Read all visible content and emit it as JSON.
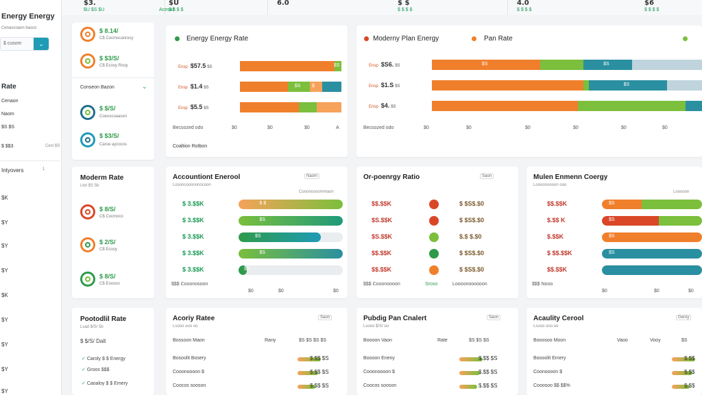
{
  "top": {
    "metrics": [
      {
        "value": "$3.",
        "sub": "$U $S $U"
      },
      {
        "value": "$U",
        "sub": "$ $ $ $"
      },
      {
        "value": "6.0",
        "sub": "Acesalt"
      },
      {
        "value": "$ $",
        "sub": "$ $ $ $"
      },
      {
        "value": "4.0",
        "sub": "$ $ $ $"
      },
      {
        "value": "$6",
        "sub": "$ $ $ $"
      }
    ]
  },
  "sidebar": {
    "title": "Energy Energy",
    "subtitle": "Cenascoaon basco",
    "select_value": "$ cusom",
    "heading": "Rate",
    "rows": [
      {
        "label": "Cenaon",
        "right": ""
      },
      {
        "label": "Naom",
        "right": ""
      },
      {
        "label": "$S $S",
        "right": ""
      },
      {
        "label": "$ $$3",
        "right": "Cest   $S"
      }
    ],
    "list_heading": "Intyovers",
    "list_right": "1",
    "list": [
      "$K",
      "$Y",
      "$Y",
      "$Y",
      "$Y",
      "$K",
      "$Y",
      "$Y",
      "$Y"
    ]
  },
  "icon_card_top": {
    "items": [
      {
        "value": "$ 8.14/",
        "sub": "C$ Cocmocanrocy"
      },
      {
        "value": "$ $3/S/",
        "sub": "C$ Ecooy Rooy"
      }
    ],
    "dropdown": "Conseon Bazon",
    "items2": [
      {
        "value": "$ $/S/",
        "sub": "Coeoscoaacen"
      },
      {
        "value": "$ $3/S/",
        "sub": "Caroe aycocos"
      }
    ]
  },
  "card_energy_rate": {
    "legend": "Energy Energy Rate",
    "rows": [
      {
        "small": "Ensp",
        "big": "$57.5",
        "unit": "$S",
        "segs": [
          {
            "p": 0.93,
            "label": ""
          },
          {
            "p": 0.07,
            "label": "$S"
          }
        ]
      },
      {
        "small": "Ensp",
        "big": "$1.4",
        "unit": "$S",
        "segs": [
          {
            "p": 0.47,
            "label": ""
          },
          {
            "p": 0.22,
            "label": "$S"
          },
          {
            "p": 0.12,
            "label": "$"
          },
          {
            "p": 0.19,
            "label": ""
          }
        ]
      },
      {
        "small": "Ensp",
        "big": "$5.5",
        "unit": "$S",
        "segs": [
          {
            "p": 0.58,
            "label": ""
          },
          {
            "p": 0.18,
            "label": ""
          },
          {
            "p": 0.24,
            "label": ""
          }
        ]
      }
    ],
    "axis": [
      "Becsozed odo",
      "$0",
      "$0",
      "$0",
      "A"
    ],
    "footer": "Coaltion Rotbon"
  },
  "card_plan": {
    "legend1": "Moderny Plan Energy",
    "legend2": "Pan Rate",
    "rows": [
      {
        "small": "Ensp",
        "big": "$S6.",
        "unit": "$S",
        "segs": [
          {
            "p": 0.4,
            "label": "$S"
          },
          {
            "p": 0.16,
            "label": ""
          },
          {
            "p": 0.18,
            "label": "$S"
          },
          {
            "p": 0.26,
            "label": ""
          }
        ]
      },
      {
        "small": "Ensp",
        "big": "$1.S",
        "unit": "$S",
        "segs": [
          {
            "p": 0.56,
            "label": ""
          },
          {
            "p": 0.02,
            "label": ""
          },
          {
            "p": 0.29,
            "label": "$S"
          },
          {
            "p": 0.13,
            "label": ""
          }
        ]
      },
      {
        "small": "Ensp",
        "big": "$4.",
        "unit": "$S",
        "segs": [
          {
            "p": 0.54,
            "label": ""
          },
          {
            "p": 0.4,
            "label": ""
          },
          {
            "p": 0.06,
            "label": ""
          }
        ]
      }
    ],
    "axis": [
      "Becsozed odo",
      "$0",
      "$0",
      "$0",
      "$0",
      "$0",
      "$0",
      "$0"
    ]
  },
  "card_modern_rate": {
    "title": "Moderm Rate",
    "sub": "Ltot $S 5b",
    "items": [
      {
        "value": "$ 8/S/",
        "sub": "C$ Cocmoco"
      },
      {
        "value": "$ 2/S/",
        "sub": "C$ Ecooy"
      },
      {
        "value": "$ 8/S/",
        "sub": "C$ Eoosoo"
      }
    ]
  },
  "card_acc_energy": {
    "title": "Accountiont Enerool",
    "sub": "Losoncooononocoon",
    "badge": "Naom",
    "subright": "Cooonosoommaon",
    "rows": [
      {
        "value": "$ 3.$$K",
        "fill": 1.0,
        "label": "$ $"
      },
      {
        "value": "$ 3.$$K",
        "fill": 1.0,
        "label": "$S"
      },
      {
        "value": "$ 3.$$K",
        "fill": 0.79,
        "label": "$S"
      },
      {
        "value": "$ 3.$$K",
        "fill": 1.0,
        "label": "$S"
      },
      {
        "value": "$ 3.$$K",
        "fill": 0.08,
        "label": "$S"
      }
    ],
    "axis_left": "$$$ Cooonosoon",
    "axis": [
      "$0",
      "$0",
      "$0"
    ]
  },
  "card_ratio": {
    "title": "Or-poenrgy Ratio",
    "badge": "Saon",
    "rows": [
      {
        "left": "$$.$$K",
        "right": "$ $S$.$0"
      },
      {
        "left": "$S.$$K",
        "right": "$ $S$.$0"
      },
      {
        "left": "$S.$$K",
        "right": "$.$ $.$0"
      },
      {
        "left": "$$.$$K",
        "right": "$ $S$.$0"
      },
      {
        "left": "$$.$$K",
        "right": "$ $S$.$0"
      }
    ],
    "foot_left": "$$$ Cooonoooon",
    "foot_mid": "Sroso",
    "foot_right": "Loooonoooooon"
  },
  "card_modern_energy": {
    "title": "Mulen Enmenn Coergy",
    "sub": "Loooonoooon ooo",
    "subright": "Looooon",
    "rows": [
      {
        "value": "$$.$$K",
        "fills": [
          0.4,
          0.6
        ],
        "label": "$S"
      },
      {
        "value": "$.$$ K",
        "fills": [
          0.57,
          0.43
        ],
        "label": "$S"
      },
      {
        "value": "$.$$K",
        "fills": [
          1.0
        ],
        "label": "$S"
      },
      {
        "value": "$ $$.$$K",
        "fills": [
          1.0
        ],
        "label": "$S"
      },
      {
        "value": "$$.$$K",
        "fills": [
          1.0
        ],
        "label": ""
      }
    ],
    "axis_left": "$$$ Nooo",
    "axis": [
      "$0",
      "$0",
      "$0"
    ]
  },
  "card_potential": {
    "title": "Pootodlil Rate",
    "sub": "Lsad $/S/ 5b",
    "head": "$ $/S/ Dalt",
    "items": [
      {
        "label": "Caroly",
        "value": "$ $ Energy"
      },
      {
        "label": "Groos",
        "value": "$$$"
      },
      {
        "label": "Caoaloy",
        "value": "$ $ Emery"
      }
    ]
  },
  "card_acc_rate": {
    "title": "Acoriy Ratee",
    "sub": "Lsooo ooo oo",
    "badge": "Saon",
    "cols": [
      "Bossoon Maon",
      "Rany",
      "$S $S $S $S"
    ],
    "rows": [
      {
        "label": "Bosoolit Bosery",
        "value": "$.$$ $S"
      },
      {
        "label": "Cooonoooon $",
        "value": "$.$$ $S"
      },
      {
        "label": "Coocos sooson",
        "value": "$.$$ $S"
      }
    ]
  },
  "card_pub_plan": {
    "title": "Pubdig Pan Cnalert",
    "sub": "Lsooo $/S/ oo",
    "badge": "Saon",
    "cols": [
      "Boooon Vaon",
      "Rate",
      "$S $S $S"
    ],
    "rows": [
      {
        "label": "Boooon Eneny",
        "value": "$.$$ $S"
      },
      {
        "label": "Cooonoooon $",
        "value": "$.$$ $S"
      },
      {
        "label": "Coocos sooson",
        "value": "$.$$ $S"
      }
    ]
  },
  "card_acuity": {
    "title": "Acaulity Cerool",
    "sub": "Lsooo ooo oo",
    "badge": "Geroy",
    "cols": [
      "Booosoo Moon",
      "Vaoo",
      "Vooy",
      "$S"
    ],
    "rows": [
      {
        "label": "Boooolit Emery",
        "value": "$.$$"
      },
      {
        "label": "Coonoooon $",
        "value": "$.$$"
      },
      {
        "label": "Cooosoo $$ $$%",
        "value": "$.$$"
      }
    ]
  },
  "colors": {
    "orange": "#f07f2c",
    "lightorange": "#f6a25a",
    "green": "#7bbf3c",
    "teal": "#2a8fa0",
    "darkteal": "#1f6f8b",
    "red": "#d94727",
    "accent": "#1e9bb5"
  }
}
